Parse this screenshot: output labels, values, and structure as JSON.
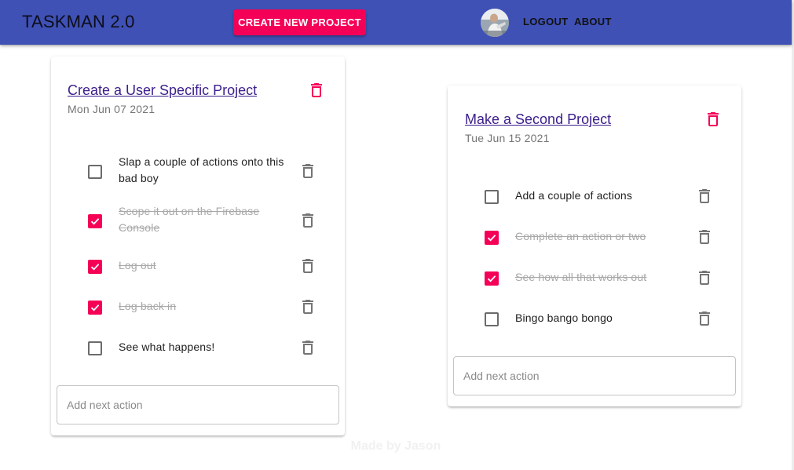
{
  "app": {
    "brand": "TASKMAN 2.0",
    "create_button": "CREATE NEW PROJECT",
    "nav": {
      "logout": "LOGOUT",
      "about": "ABOUT"
    }
  },
  "projects": [
    {
      "title": "Create a User Specific Project",
      "date": "Mon Jun 07 2021",
      "input_placeholder": "Add next action",
      "actions": [
        {
          "text": "Slap a couple of actions onto this bad boy",
          "done": false
        },
        {
          "text": "Scope it out on the Firebase Console",
          "done": true
        },
        {
          "text": "Log out",
          "done": true
        },
        {
          "text": "Log back in",
          "done": true
        },
        {
          "text": "See what happens!",
          "done": false
        }
      ]
    },
    {
      "title": "Make a Second Project",
      "date": "Tue Jun 15 2021",
      "input_placeholder": "Add next action",
      "actions": [
        {
          "text": "Add a couple of actions",
          "done": false
        },
        {
          "text": "Complete an action or two",
          "done": true
        },
        {
          "text": "See how all that works out",
          "done": true
        },
        {
          "text": "Bingo bango bongo",
          "done": false
        }
      ]
    }
  ],
  "footer": {
    "text": "Made by Jason"
  },
  "colors": {
    "appbar": "#3f51b5",
    "accent": "#f50057",
    "title_link": "#3c1e8c",
    "done_text": "#a8a8a8"
  },
  "icons": {
    "delete_project": "trash-icon",
    "delete_action": "trash-outline-icon",
    "checked": "checkbox-checked-icon",
    "unchecked": "checkbox-empty-icon"
  }
}
